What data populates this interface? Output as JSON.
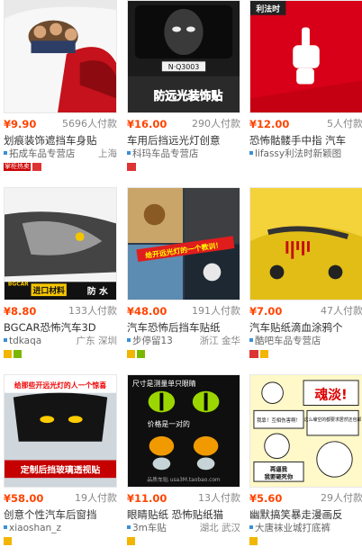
{
  "products": [
    {
      "price": "¥9.90",
      "sales": "5696人付款",
      "title": "划痕装饰遮挡车身贴",
      "shop": "拓成车品专营店",
      "location": "上海",
      "badges": [
        "shop-label",
        "mail"
      ],
      "shop_label": "掌柜热卖",
      "thumb": "car-sticker-cartoon"
    },
    {
      "price": "¥16.00",
      "sales": "290人付款",
      "title": "车用后挡远光灯创意",
      "shop": "科玛车品专营店",
      "location": "",
      "badges": [
        "mail"
      ],
      "thumb": "ghost-rear-window",
      "overlay_text": "防远光装饰贴",
      "plate_text": "N·Q3003"
    },
    {
      "price": "¥12.00",
      "sales": "5人付款",
      "title": "恐怖骷髅手中指 汽车",
      "shop": "lifassy利法时新颖图",
      "location": "",
      "badges": [],
      "thumb": "skeleton-hand",
      "brand_text": "利法时"
    },
    {
      "price": "¥8.80",
      "sales": "133人付款",
      "title": "BGCAR恐怖汽车3D",
      "shop": "tdkaqa",
      "location": "广东 深圳",
      "badges": [
        "yellow",
        "green"
      ],
      "thumb": "wolf-sticker",
      "brand_text": "BGCAR",
      "import_text": "进口材料",
      "water_text": "防 水"
    },
    {
      "price": "¥48.00",
      "sales": "191人付款",
      "title": "汽车恐怖后挡车贴纸",
      "shop": "步停留13",
      "location": "浙江 金华",
      "badges": [
        "yellow",
        "green"
      ],
      "thumb": "tiger-rear-window",
      "overlay_text": "给开远光灯的一个教训！"
    },
    {
      "price": "¥7.00",
      "sales": "47人付款",
      "title": "汽车贴纸滴血涂鸦个",
      "shop": "酷吧车品专营店",
      "location": "",
      "badges": [
        "mail",
        "yellow"
      ],
      "thumb": "blood-drip-car"
    },
    {
      "price": "¥58.00",
      "sales": "19人付款",
      "title": "创意个性汽车后窗挡",
      "shop": "xiaoshan_z",
      "location": "",
      "badges": [
        "yellow"
      ],
      "thumb": "dark-window-sticker",
      "overlay_text": "给那些开远光灯的人一个惊喜",
      "banner_text": "定制后挡玻璃透视贴"
    },
    {
      "price": "¥11.00",
      "sales": "13人付款",
      "title": "眼睛贴纸 恐怖贴纸猫",
      "shop": "3m车贴",
      "location": "湖北 武汉",
      "badges": [
        "yellow"
      ],
      "thumb": "cat-eyes",
      "top_text": "尺寸是测量单只眼睛",
      "mid_text": "价格是一对的",
      "watermark": "品质车贴 usa3M.taobao.com"
    },
    {
      "price": "¥5.60",
      "sales": "29人付款",
      "title": "幽默搞笑暴走漫画反",
      "shop": "大唐袜业城打底裤",
      "location": "",
      "badges": [
        "yellow"
      ],
      "thumb": "meme-sticker",
      "headline": "魂淡!",
      "line1": "我靠！互相伤害啊！",
      "line2": "这么壕空的都要求居然还包邮",
      "line3": "再逼我",
      "line4": "我要砸死你"
    }
  ]
}
